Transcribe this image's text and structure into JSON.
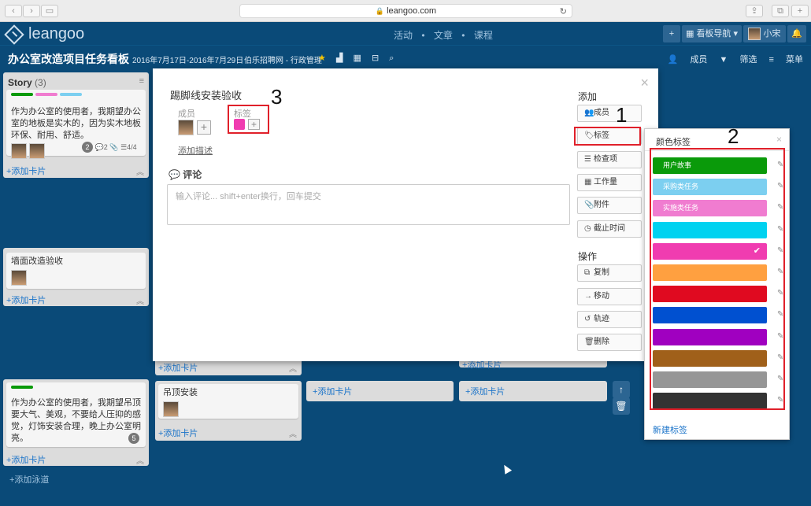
{
  "browser": {
    "url": "leangoo.com"
  },
  "app": {
    "logo": "leangoo",
    "nav": [
      "活动",
      "文章",
      "课程"
    ],
    "nav_sep": "•",
    "board_nav": "看板导航",
    "user": "小宋"
  },
  "board": {
    "title": "办公室改造项目任务看板",
    "date": "2016年7月17日-2016年7月29日",
    "org": "伯乐招聘网 - 行政管理",
    "members": "成员",
    "filter": "筛选",
    "menu": "菜单"
  },
  "lanes": {
    "story": {
      "name": "Story",
      "count": "(3)"
    },
    "add_card": "+添加卡片",
    "add_lane": "+添加泳道"
  },
  "cards": [
    {
      "text": "作为办公室的使用者，我期望办公室的地板是实木的，因为实木地板环保、耐用、舒适。",
      "stats": {
        "badge": "2",
        "comments": "2",
        "checks": "4/4"
      }
    },
    {
      "text": "墙面改造验收"
    },
    {
      "text": "作为办公室的使用者，我期望吊顶要大气、美观，不要给人压抑的感觉，灯饰安装合理，晚上办公室明亮。",
      "badge": "5"
    },
    {
      "text": "吊顶安装"
    }
  ],
  "modal": {
    "card_name": "踢脚线安装验收",
    "members_label": "成员",
    "tags_label": "标签",
    "plus": "+",
    "add_description": "添加描述",
    "comment_title": "评论",
    "comment_placeholder": "输入评论... shift+enter换行，回车提交",
    "add_title": "添加",
    "actions_title": "操作",
    "add_buttons": [
      "成员",
      "标签",
      "检查项",
      "工作量",
      "附件",
      "截止时间"
    ],
    "action_buttons": [
      "复制",
      "移动",
      "轨迹",
      "删除"
    ],
    "close": "×"
  },
  "label_popup": {
    "title": "颜色标签",
    "close": "×",
    "new_label": "新建标签",
    "labels": [
      {
        "name": "用户故事",
        "color": "#0a9a0a"
      },
      {
        "name": "采购类任务",
        "color": "#7ccff0"
      },
      {
        "name": "实施类任务",
        "color": "#f07cd0"
      },
      {
        "name": "",
        "color": "#00d2f0"
      },
      {
        "name": "",
        "color": "#f03cb0",
        "checked": true
      },
      {
        "name": "",
        "color": "#ffa040"
      },
      {
        "name": "",
        "color": "#e00a20"
      },
      {
        "name": "",
        "color": "#0050d0"
      },
      {
        "name": "",
        "color": "#a000c0"
      },
      {
        "name": "",
        "color": "#a0601a"
      },
      {
        "name": "",
        "color": "#969696"
      },
      {
        "name": "",
        "color": "#333333"
      }
    ]
  },
  "annotations": [
    "1",
    "2",
    "3"
  ],
  "colors": {
    "accent": "#1a73c9",
    "header": "#0a4a78",
    "highlight": "#e0202a",
    "selected_tag": "#f03cb0"
  }
}
